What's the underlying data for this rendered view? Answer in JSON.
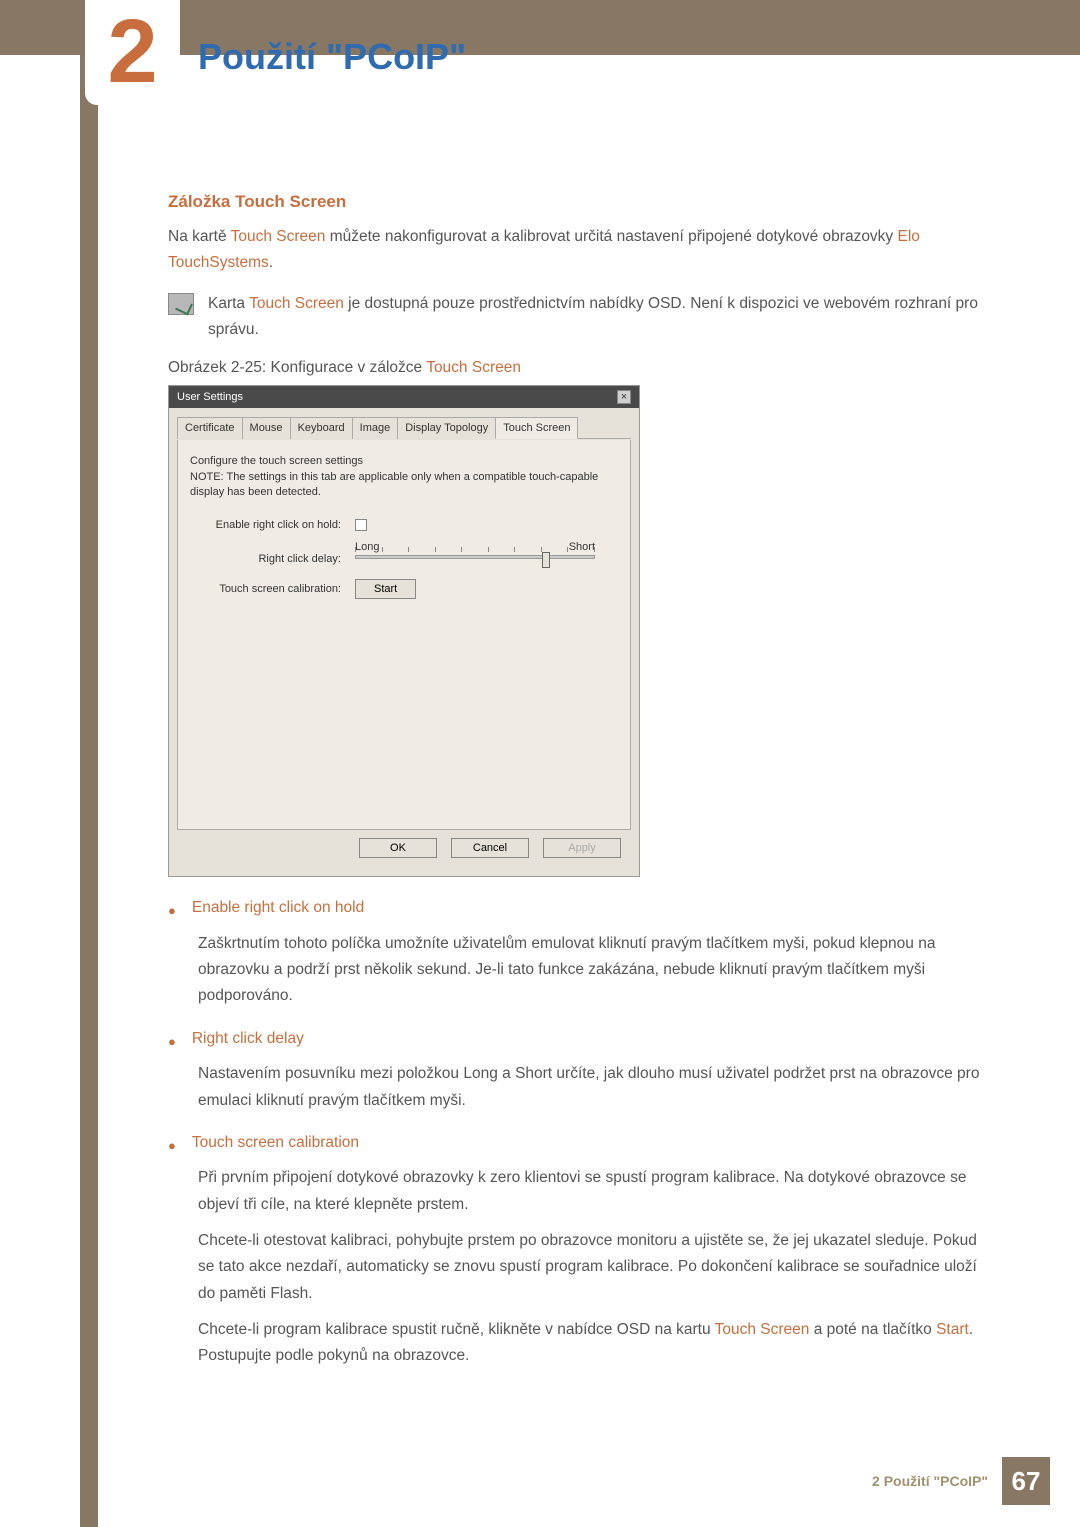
{
  "chapter": {
    "number": "2",
    "title": "Použití \"PCoIP\""
  },
  "section": {
    "heading": "Záložka Touch Screen",
    "intro_pre": "Na kartě ",
    "intro_link1": "Touch Screen",
    "intro_mid": " můžete nakonfigurovat a kalibrovat určitá nastavení připojené dotykové obrazovky  ",
    "intro_link2": "Elo TouchSystems",
    "intro_post": "."
  },
  "note": {
    "pre": "Karta ",
    "link": "Touch Screen",
    "post": " je dostupná pouze prostřednictvím nabídky OSD. Není k dispozici ve webovém rozhraní pro správu."
  },
  "figure": {
    "caption_pre": "Obrázek 2-25: Konfigurace v záložce ",
    "caption_link": "Touch Screen"
  },
  "dialog": {
    "title": "User Settings",
    "tabs": [
      "Certificate",
      "Mouse",
      "Keyboard",
      "Image",
      "Display Topology",
      "Touch Screen"
    ],
    "active_tab": 5,
    "cfg_line1": "Configure the touch screen settings",
    "cfg_line2": "NOTE: The settings in this tab are applicable only when a compatible touch-capable display has been detected.",
    "rows": {
      "enable_label": "Enable right click on hold:",
      "delay_label": "Right click delay:",
      "delay_left": "Long",
      "delay_right": "Short",
      "calib_label": "Touch screen calibration:",
      "start_btn": "Start"
    },
    "buttons": {
      "ok": "OK",
      "cancel": "Cancel",
      "apply": "Apply"
    }
  },
  "bullets": [
    {
      "heading": "Enable right click on hold",
      "paras": [
        "Zaškrtnutím tohoto políčka umožníte uživatelům emulovat kliknutí pravým tlačítkem myši, pokud klepnou na obrazovku a podrží prst několik sekund. Je-li tato funkce zakázána, nebude kliknutí pravým tlačítkem myši podporováno."
      ]
    },
    {
      "heading": "Right click delay",
      "paras": [
        "Nastavením posuvníku mezi položkou Long a Short určíte, jak dlouho musí uživatel podržet prst na obrazovce pro emulaci kliknutí pravým tlačítkem myši."
      ]
    },
    {
      "heading": "Touch screen calibration",
      "paras": [
        "Při prvním připojení dotykové obrazovky k zero klientovi se spustí program kalibrace. Na dotykové obrazovce se objeví tři cíle, na které klepněte prstem.",
        "Chcete-li otestovat kalibraci, pohybujte prstem po obrazovce monitoru a ujistěte se, že jej ukazatel sleduje. Pokud se tato akce nezdaří, automaticky se znovu spustí program kalibrace. Po dokončení kalibrace se souřadnice uloží do paměti Flash."
      ],
      "final_pre": "Chcete-li program kalibrace spustit ručně, klikněte v nabídce OSD na kartu ",
      "final_link1": "Touch Screen",
      "final_mid": " a poté na tlačítko ",
      "final_link2": "Start",
      "final_post": ". Postupujte podle pokynů na obrazovce."
    }
  ],
  "footer": {
    "text": "2 Použití \"PCoIP\"",
    "page": "67"
  }
}
